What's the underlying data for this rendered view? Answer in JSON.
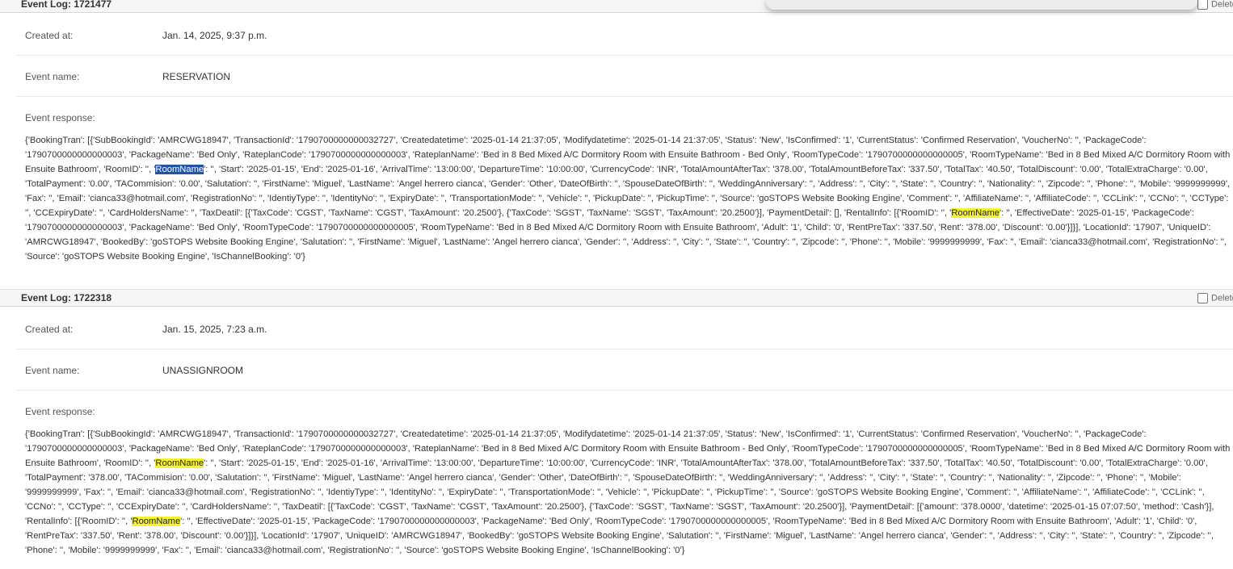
{
  "logs": [
    {
      "title": "Event Log: 1721477",
      "delete_label": "Delete",
      "created_label": "Created at:",
      "created_value": "Jan. 14, 2025, 9:37 p.m.",
      "event_name_label": "Event name:",
      "event_name_value": "RESERVATION",
      "response_label": "Event response:",
      "response_parts": [
        "{'BookingTran': [{'SubBookingId': 'AMRCWG18947', 'TransactionId': '1790700000000032727', 'Createdatetime': '2025-01-14 21:37:05', 'Modifydatetime': '2025-01-14 21:37:05', 'Status': 'New', 'IsConfirmed': '1', 'CurrentStatus': 'Confirmed Reservation', 'VoucherNo': '', 'PackageCode': '1790700000000000003', 'PackageName': 'Bed Only', 'RateplanCode': '1790700000000000003', 'RateplanName': 'Bed in 8 Bed Mixed A/C Dormitory Room with Ensuite Bathroom - Bed Only', 'RoomTypeCode': '1790700000000000005', 'RoomTypeName': 'Bed in 8 Bed Mixed A/C Dormitory Room with Ensuite Bathroom', 'RoomID': '', '",
        "RoomName",
        "': '', 'Start': '2025-01-15', 'End': '2025-01-16', 'ArrivalTime': '13:00:00', 'DepartureTime': '10:00:00', 'CurrencyCode': 'INR', 'TotalAmountAfterTax': '378.00', 'TotalAmountBeforeTax': '337.50', 'TotalTax': '40.50', 'TotalDiscount': '0.00', 'TotalExtraCharge': '0.00', 'TotalPayment': '0.00', 'TACommision': '0.00', 'Salutation': '', 'FirstName': 'Miguel', 'LastName': 'Angel herrero cianca', 'Gender': 'Other', 'DateOfBirth': '', 'SpouseDateOfBirth': '', 'WeddingAnniversary': '', 'Address': '', 'City': '', 'State': '', 'Country': '', 'Nationality': '', 'Zipcode': '', 'Phone': '', 'Mobile': '9999999999', 'Fax': '', 'Email': 'cianca33@hotmail.com', 'RegistrationNo': '', 'IdentiyType': '', 'IdentityNo': '', 'ExpiryDate': '', 'TransportationMode': '', 'Vehicle': '', 'PickupDate': '', 'PickupTime': '', 'Source': 'goSTOPS Website Booking Engine', 'Comment': '', 'AffiliateName': '', 'AffiliateCode': '', 'CCLink': '', 'CCNo': '', 'CCType': '', 'CCExpiryDate': '', 'CardHoldersName': '', 'TaxDeatil': [{'TaxCode': 'CGST', 'TaxName': 'CGST', 'TaxAmount': '20.2500'}, {'TaxCode': 'SGST', 'TaxName': 'SGST', 'TaxAmount': '20.2500'}], 'PaymentDetail': [], 'RentalInfo': [{'RoomID': '', '",
        "RoomName",
        "': '', 'EffectiveDate': '2025-01-15', 'PackageCode': '1790700000000000003', 'PackageName': 'Bed Only', 'RoomTypeCode': '1790700000000000005', 'RoomTypeName': 'Bed in 8 Bed Mixed A/C Dormitory Room with Ensuite Bathroom', 'Adult': '1', 'Child': '0', 'RentPreTax': '337.50', 'Rent': '378.00', 'Discount': '0.00'}]}], 'LocationId': '17907', 'UniqueID': 'AMRCWG18947', 'BookedBy': 'goSTOPS Website Booking Engine', 'Salutation': '', 'FirstName': 'Miguel', 'LastName': 'Angel herrero cianca', 'Gender': '', 'Address': '', 'City': '', 'State': '', 'Country': '', 'Zipcode': '', 'Phone': '', 'Mobile': '9999999999', 'Fax': '', 'Email': 'cianca33@hotmail.com', 'RegistrationNo': '', 'Source': 'goSTOPS Website Booking Engine', 'IsChannelBooking': '0'}"
      ]
    },
    {
      "title": "Event Log: 1722318",
      "delete_label": "Delete",
      "created_label": "Created at:",
      "created_value": "Jan. 15, 2025, 7:23 a.m.",
      "event_name_label": "Event name:",
      "event_name_value": "UNASSIGNROOM",
      "response_label": "Event response:",
      "response_parts": [
        "{'BookingTran': [{'SubBookingId': 'AMRCWG18947', 'TransactionId': '1790700000000032727', 'Createdatetime': '2025-01-14 21:37:05', 'Modifydatetime': '2025-01-14 21:37:05', 'Status': 'New', 'IsConfirmed': '1', 'CurrentStatus': 'Confirmed Reservation', 'VoucherNo': '', 'PackageCode': '1790700000000000003', 'PackageName': 'Bed Only', 'RateplanCode': '1790700000000000003', 'RateplanName': 'Bed in 8 Bed Mixed A/C Dormitory Room with Ensuite Bathroom - Bed Only', 'RoomTypeCode': '1790700000000000005', 'RoomTypeName': 'Bed in 8 Bed Mixed A/C Dormitory Room with Ensuite Bathroom', 'RoomID': '', '",
        "RoomName",
        "': '', 'Start': '2025-01-15', 'End': '2025-01-16', 'ArrivalTime': '13:00:00', 'DepartureTime': '10:00:00', 'CurrencyCode': 'INR', 'TotalAmountAfterTax': '378.00', 'TotalAmountBeforeTax': '337.50', 'TotalTax': '40.50', 'TotalDiscount': '0.00', 'TotalExtraCharge': '0.00', 'TotalPayment': '378.00', 'TACommision': '0.00', 'Salutation': '', 'FirstName': 'Miguel', 'LastName': 'Angel herrero cianca', 'Gender': 'Other', 'DateOfBirth': '', 'SpouseDateOfBirth': '', 'WeddingAnniversary': '', 'Address': '', 'City': '', 'State': '', 'Country': '', 'Nationality': '', 'Zipcode': '', 'Phone': '', 'Mobile': '9999999999', 'Fax': '', 'Email': 'cianca33@hotmail.com', 'RegistrationNo': '', 'IdentiyType': '', 'IdentityNo': '', 'ExpiryDate': '', 'TransportationMode': '', 'Vehicle': '', 'PickupDate': '', 'PickupTime': '', 'Source': 'goSTOPS Website Booking Engine', 'Comment': '', 'AffiliateName': '', 'AffiliateCode': '', 'CCLink': '', 'CCNo': '', 'CCType': '', 'CCExpiryDate': '', 'CardHoldersName': '', 'TaxDeatil': [{'TaxCode': 'CGST', 'TaxName': 'CGST', 'TaxAmount': '20.2500'}, {'TaxCode': 'SGST', 'TaxName': 'SGST', 'TaxAmount': '20.2500'}], 'PaymentDetail': [{'amount': '378.0000', 'datetime': '2025-01-15 07:07:50', 'method': 'Cash'}], 'RentalInfo': [{'RoomID': '', '",
        "RoomName",
        "': '', 'EffectiveDate': '2025-01-15', 'PackageCode': '1790700000000000003', 'PackageName': 'Bed Only', 'RoomTypeCode': '1790700000000000005', 'RoomTypeName': 'Bed in 8 Bed Mixed A/C Dormitory Room with Ensuite Bathroom', 'Adult': '1', 'Child': '0', 'RentPreTax': '337.50', 'Rent': '378.00', 'Discount': '0.00'}]}], 'LocationId': '17907', 'UniqueID': 'AMRCWG18947', 'BookedBy': 'goSTOPS Website Booking Engine', 'Salutation': '', 'FirstName': 'Miguel', 'LastName': 'Angel herrero cianca', 'Gender': '', 'Address': '', 'City': '', 'State': '', 'Country': '', 'Zipcode': '', 'Phone': '', 'Mobile': '9999999999', 'Fax': '', 'Email': 'cianca33@hotmail.com', 'RegistrationNo': '', 'Source': 'goSTOPS Website Booking Engine', 'IsChannelBooking': '0'}"
      ]
    }
  ],
  "colors": {
    "selection_highlight": "#2353a6",
    "search_highlight": "#f5f232",
    "header_bg": "#f6f6f6"
  }
}
